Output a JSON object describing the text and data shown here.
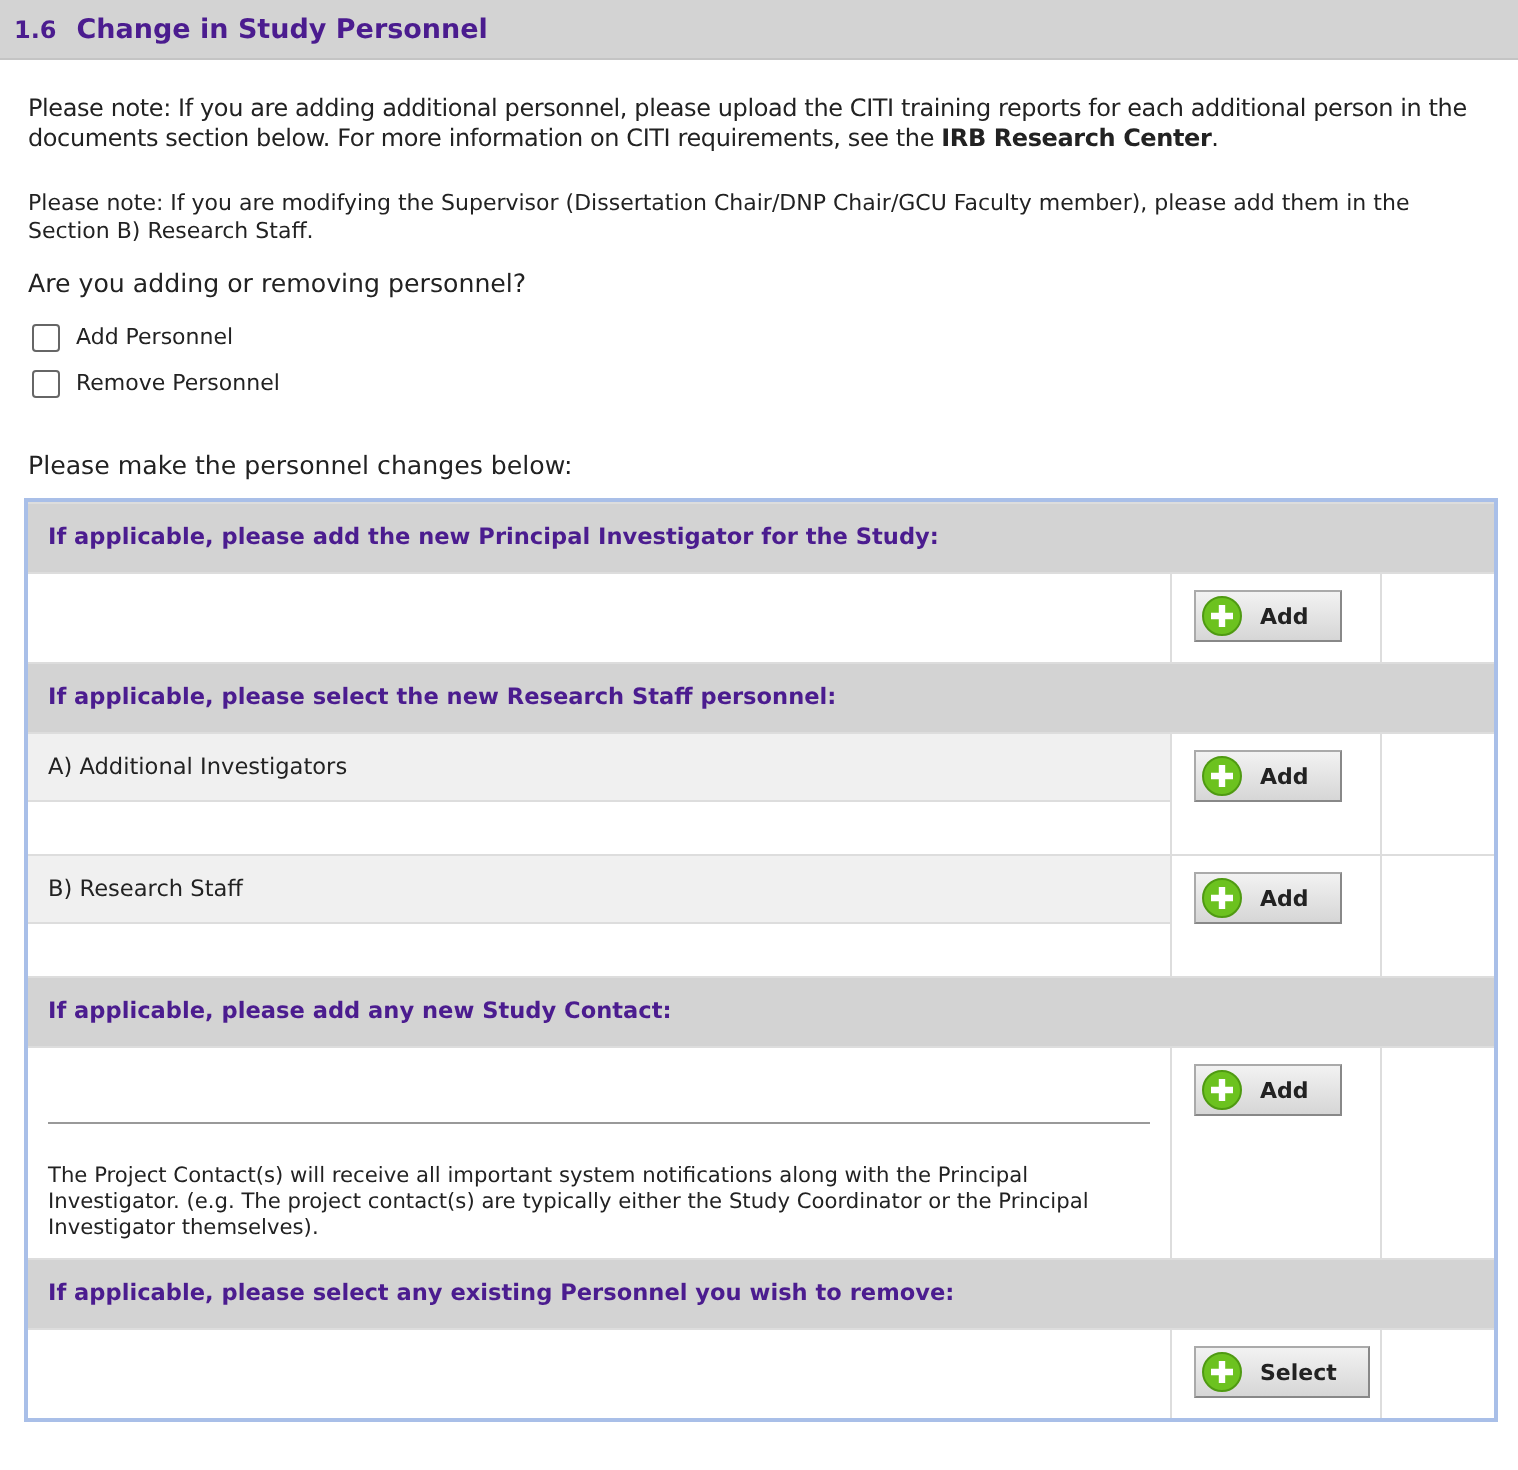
{
  "section": {
    "number": "1.6",
    "title": "Change in Study Personnel"
  },
  "notes": [
    {
      "kind": "large",
      "text": "Please note: If you are adding additional personnel, please upload the CITI training reports for each additional person in the documents section below. For more information on CITI requirements, see the **IRB Research Center**."
    },
    {
      "kind": "small",
      "text": "Please note: If you are modifying the Supervisor (Dissertation Chair/DNP Chair/GCU Faculty member), please add them in the Section B) Research Staff."
    }
  ],
  "question": "Are you adding or removing personnel?",
  "options": [
    {
      "label": "Add Personnel",
      "checked": false
    },
    {
      "label": "Remove Personnel",
      "checked": false
    }
  ],
  "changes_intro": "Please make the personnel changes below:",
  "groups": [
    {
      "heading": "If applicable, please add the new Principal Investigator for the Study:",
      "rows": [
        {
          "kind": "empty",
          "button": "Add"
        }
      ]
    },
    {
      "heading": "If applicable, please select the new Research Staff personnel:",
      "rows": [
        {
          "kind": "labeled",
          "label": "A) Additional Investigators",
          "button": "Add"
        },
        {
          "kind": "labeled",
          "label": "B) Research Staff",
          "button": "Add"
        }
      ]
    },
    {
      "heading": "If applicable, please add any new Study Contact:",
      "rows": [
        {
          "kind": "contact",
          "note": "The Project Contact(s) will receive all important system notifications along with the Principal Investigator. (e.g. The project contact(s) are typically either the Study Coordinator or the Principal Investigator themselves).",
          "button": "Add"
        }
      ]
    },
    {
      "heading": "If applicable, please select any existing Personnel you wish to remove:",
      "rows": [
        {
          "kind": "empty",
          "button": "Select"
        }
      ]
    }
  ]
}
